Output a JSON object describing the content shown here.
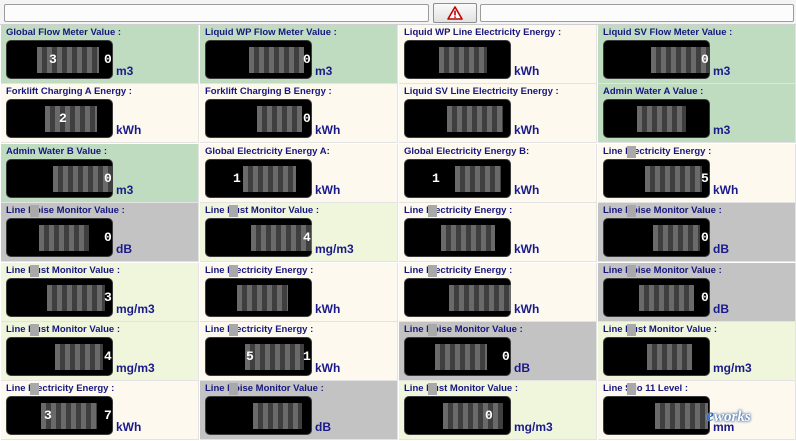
{
  "toolbar": {
    "alert_icon": "warning-triangle-icon",
    "alert_color": "#c00000"
  },
  "tiles": [
    {
      "label": "Global Flow Meter Value :",
      "unit": "m3",
      "bg": "green",
      "digits": [
        [
          "3",
          42
        ],
        [
          "0",
          97
        ]
      ]
    },
    {
      "label": "Liquid WP Flow Meter Value :",
      "unit": "m3",
      "bg": "green",
      "digits": [
        [
          "0",
          97
        ]
      ]
    },
    {
      "label": "Liquid WP Line Electricity Energy :",
      "unit": "kWh",
      "bg": "cream",
      "digits": []
    },
    {
      "label": "Liquid SV Flow Meter Value :",
      "unit": "m3",
      "bg": "green",
      "digits": [
        [
          "0",
          97
        ]
      ]
    },
    {
      "label": "Forklift Charging A Energy :",
      "unit": "kWh",
      "bg": "cream",
      "digits": [
        [
          "2",
          52
        ]
      ]
    },
    {
      "label": "Forklift Charging B Energy :",
      "unit": "kWh",
      "bg": "cream",
      "digits": [
        [
          "0",
          97
        ]
      ]
    },
    {
      "label": "Liquid SV Line  Electricity Energy :",
      "unit": "kWh",
      "bg": "cream",
      "digits": []
    },
    {
      "label": "Admin Water A Value :",
      "unit": "m3",
      "bg": "green",
      "digits": []
    },
    {
      "label": "Admin Water B Value :",
      "unit": "m3",
      "bg": "green",
      "digits": [
        [
          "0",
          97
        ]
      ]
    },
    {
      "label": "Global Electricity Energy A:",
      "unit": "kWh",
      "bg": "cream",
      "digits": [
        [
          "1",
          27
        ]
      ]
    },
    {
      "label": "Global Electricity Energy B:",
      "unit": "kWh",
      "bg": "cream",
      "digits": [
        [
          "1",
          27
        ]
      ]
    },
    {
      "label": "Line    Electricity Energy :",
      "unit": "kWh",
      "bg": "cream",
      "digits": [
        [
          "5",
          97
        ]
      ]
    },
    {
      "label": "Line    Noise Monitor  Value  :",
      "unit": "dB",
      "bg": "gray",
      "digits": [
        [
          "0",
          97
        ]
      ]
    },
    {
      "label": "Line    Dust Monitor Value :",
      "unit": "mg/m3",
      "bg": "lime",
      "digits": [
        [
          "4",
          97
        ]
      ]
    },
    {
      "label": "Line    Electricity Energy :",
      "unit": "kWh",
      "bg": "cream",
      "digits": []
    },
    {
      "label": "Line    Noise Monitor  Value  :",
      "unit": "dB",
      "bg": "gray",
      "digits": [
        [
          "0",
          97
        ]
      ]
    },
    {
      "label": "Line    Dust Monitor Value :",
      "unit": "mg/m3",
      "bg": "lime",
      "digits": [
        [
          "3",
          97
        ]
      ]
    },
    {
      "label": "Line    Electricity Energy :",
      "unit": "kWh",
      "bg": "cream",
      "digits": []
    },
    {
      "label": "Line    Electricity Energy :",
      "unit": "kWh",
      "bg": "cream",
      "digits": []
    },
    {
      "label": "Line    Noise Monitor  Value  :",
      "unit": "dB",
      "bg": "gray",
      "digits": [
        [
          "0",
          97
        ]
      ]
    },
    {
      "label": "Line    Dust Monitor Value :",
      "unit": "mg/m3",
      "bg": "lime",
      "digits": [
        [
          "4",
          97
        ]
      ]
    },
    {
      "label": "Line    Electricity Energy :",
      "unit": "kWh",
      "bg": "cream",
      "digits": [
        [
          "5",
          40
        ],
        [
          "1",
          97
        ]
      ]
    },
    {
      "label": "Line    Noise Monitor  Value  :",
      "unit": "dB",
      "bg": "gray",
      "digits": [
        [
          "0",
          97
        ]
      ]
    },
    {
      "label": "Line    Dust Monitor Value :",
      "unit": "mg/m3",
      "bg": "lime",
      "digits": []
    },
    {
      "label": "Line    Electricity Energy :",
      "unit": "kWh",
      "bg": "cream",
      "digits": [
        [
          "3",
          37
        ],
        [
          "7",
          97
        ]
      ]
    },
    {
      "label": "Line    Noise Monitor  Value  :",
      "unit": "dB",
      "bg": "gray",
      "digits": []
    },
    {
      "label": "Line    Dust Monitor Value :",
      "unit": "mg/m3",
      "bg": "lime",
      "digits": [
        [
          "0",
          80
        ]
      ]
    },
    {
      "label": "Line    Silo 11 Level :",
      "unit": "mm",
      "bg": "cream",
      "digits": []
    }
  ],
  "watermark": {
    "prefix": "e",
    "text": "works"
  }
}
